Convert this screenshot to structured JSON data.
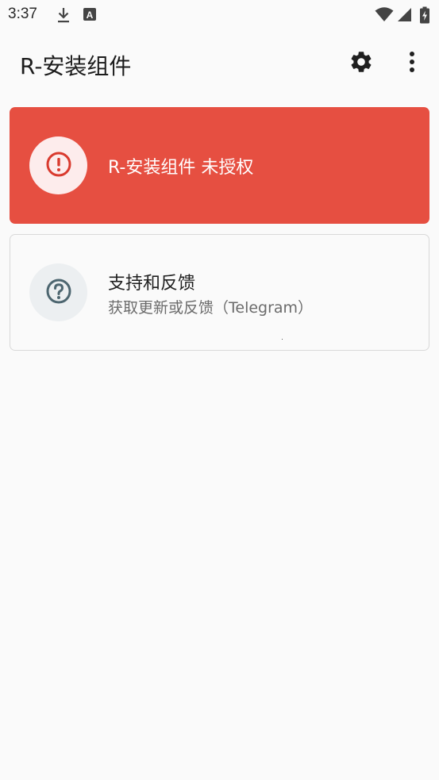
{
  "status_bar": {
    "time": "3:37",
    "icons": [
      "download-icon",
      "font-notification-icon",
      "wifi-icon",
      "signal-icon",
      "battery-charging-icon"
    ]
  },
  "app_bar": {
    "title": "R-安装组件",
    "actions": [
      "settings-gear-icon",
      "more-vert-icon"
    ]
  },
  "cards": {
    "status": {
      "icon": "error-alert-icon",
      "title": "R-安装组件 未授权",
      "color": "#e64f41"
    },
    "support": {
      "icon": "help-question-icon",
      "title": "支持和反馈",
      "subtitle": "获取更新或反馈（Telegram）"
    }
  }
}
